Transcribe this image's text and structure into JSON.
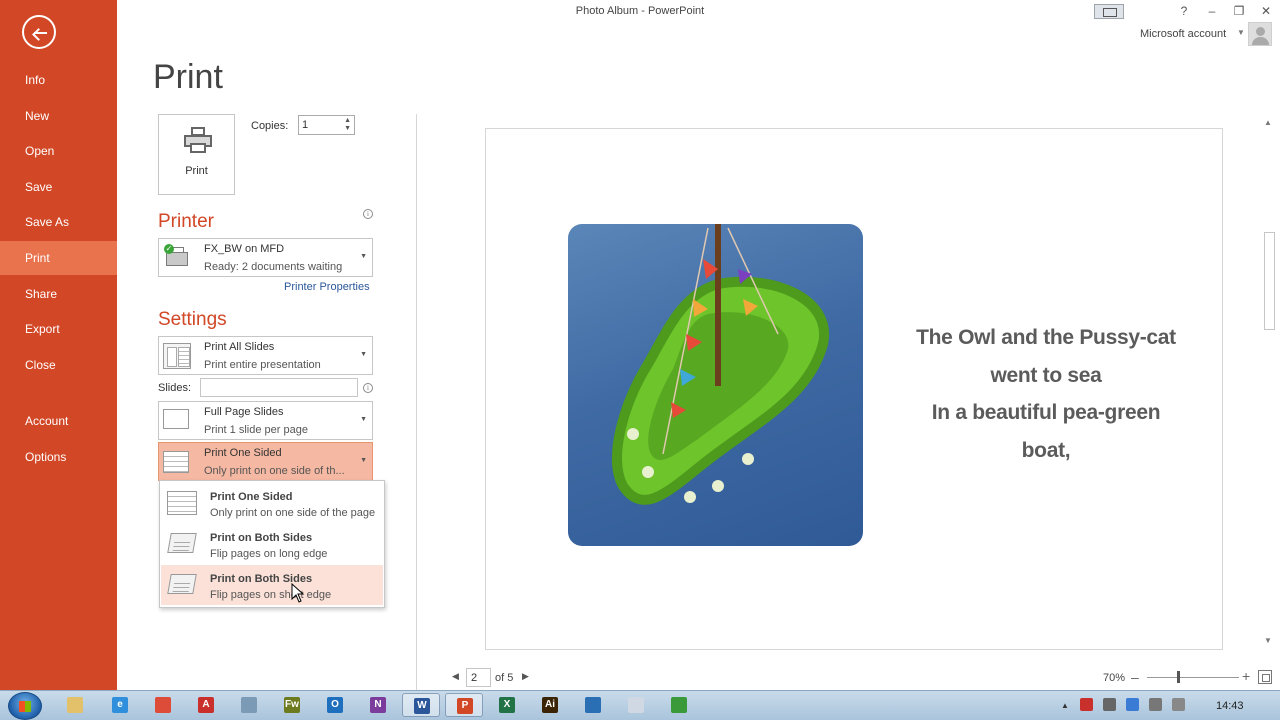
{
  "window": {
    "title": "Photo Album - PowerPoint",
    "account": "Microsoft account",
    "help": "?",
    "minimize": "–",
    "restore": "❐",
    "close": "✕"
  },
  "sidebar": {
    "back_icon": "back-arrow-icon",
    "items": [
      {
        "label": "Info"
      },
      {
        "label": "New"
      },
      {
        "label": "Open"
      },
      {
        "label": "Save"
      },
      {
        "label": "Save As"
      },
      {
        "label": "Print",
        "active": true
      },
      {
        "label": "Share"
      },
      {
        "label": "Export"
      },
      {
        "label": "Close"
      },
      {
        "label": "Account"
      },
      {
        "label": "Options"
      }
    ]
  },
  "page_title": "Print",
  "print_button": {
    "label": "Print",
    "icon": "printer-icon"
  },
  "copies": {
    "label": "Copies:",
    "value": "1"
  },
  "printer": {
    "heading": "Printer",
    "name": "FX_BW on MFD",
    "status": "Ready: 2 documents waiting",
    "properties_link": "Printer Properties"
  },
  "settings": {
    "heading": "Settings",
    "slides_range": {
      "title": "Print All Slides",
      "desc": "Print entire presentation"
    },
    "slides_label": "Slides:",
    "slides_value": "",
    "layout": {
      "title": "Full Page Slides",
      "desc": "Print 1 slide per page"
    },
    "duplex": {
      "title": "Print One Sided",
      "desc": "Only print on one side of th..."
    }
  },
  "duplex_menu": [
    {
      "title": "Print One Sided",
      "desc": "Only print on one side of the page"
    },
    {
      "title": "Print on Both Sides",
      "desc": "Flip pages on long edge"
    },
    {
      "title": "Print on Both Sides",
      "desc": "Flip pages on short edge",
      "hovered": true
    }
  ],
  "preview": {
    "slide_text": [
      "The Owl and the Pussy-cat",
      "went to sea",
      "In a beautiful pea-green",
      "boat,"
    ]
  },
  "navigation": {
    "page_number": "2",
    "page_of": "of 5"
  },
  "zoom": {
    "percent": "70%",
    "minus": "–",
    "plus": "+"
  },
  "taskbar": {
    "apps": [
      {
        "name": "file-explorer",
        "color": "#e3c06a",
        "glyph": ""
      },
      {
        "name": "internet-explorer",
        "color": "#2f8fdc",
        "glyph": "e"
      },
      {
        "name": "chrome",
        "color": "#dd4b39",
        "glyph": ""
      },
      {
        "name": "acrobat",
        "color": "#c9302c",
        "glyph": "A"
      },
      {
        "name": "snipping-tool",
        "color": "#7a9ab5",
        "glyph": ""
      },
      {
        "name": "fireworks",
        "color": "#6d7a1e",
        "glyph": "Fw"
      },
      {
        "name": "outlook",
        "color": "#1f6fbf",
        "glyph": "O"
      },
      {
        "name": "onenote",
        "color": "#7b3c9c",
        "glyph": "N"
      },
      {
        "name": "word",
        "color": "#2b579a",
        "glyph": "W",
        "active": true
      },
      {
        "name": "powerpoint",
        "color": "#d24726",
        "glyph": "P",
        "active": true
      },
      {
        "name": "excel",
        "color": "#217346",
        "glyph": "X"
      },
      {
        "name": "illustrator",
        "color": "#3b2406",
        "glyph": "Ai"
      },
      {
        "name": "remote-desktop",
        "color": "#2a6fb3",
        "glyph": ""
      },
      {
        "name": "notepad",
        "color": "#cfd8e3",
        "glyph": ""
      },
      {
        "name": "camtasia",
        "color": "#3a9a3a",
        "glyph": ""
      }
    ],
    "tray_expand": "▲",
    "clock": "14:43"
  }
}
